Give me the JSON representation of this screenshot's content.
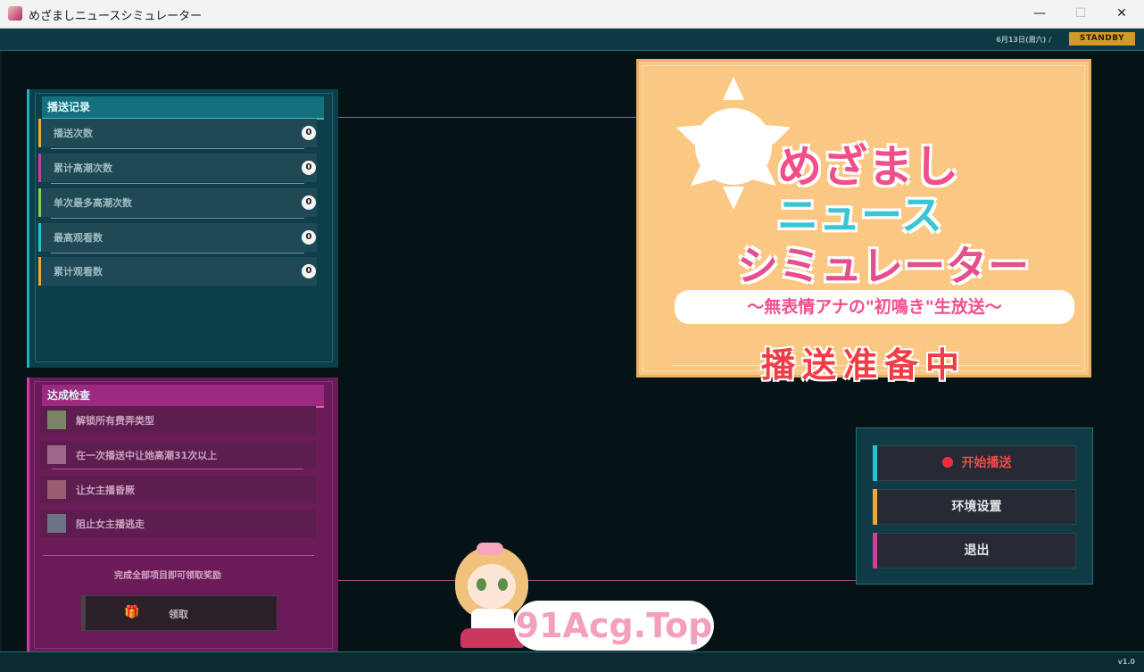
{
  "window": {
    "title": "めざましニュースシミュレーター",
    "minimize_symbol": "—",
    "maximize_symbol": "☐",
    "close_symbol": "✕"
  },
  "hud": {
    "date": "6月13日(周六) /",
    "status": "STANDBY"
  },
  "stats_panel": {
    "title": "播送记录",
    "rows": [
      {
        "label": "播送次数",
        "value": "0",
        "accent": "#f0a92c"
      },
      {
        "label": "累计高潮次数",
        "value": "0",
        "accent": "#d23a9c"
      },
      {
        "label": "单次最多高潮次数",
        "value": "0",
        "accent": "#8bd04b"
      },
      {
        "label": "最高观看数",
        "value": "0",
        "accent": "#21c4d7"
      },
      {
        "label": "累计观看数",
        "value": "0",
        "accent": "#f0a92c"
      }
    ]
  },
  "achievements_panel": {
    "title": "达成检查",
    "items": [
      {
        "label": "解锁所有费弄类型",
        "box_color": "#7a8466"
      },
      {
        "label": "在一次播送中让她高潮31次以上",
        "box_color": "#9c6788"
      },
      {
        "label": "让女主播昏厥",
        "box_color": "#9b5b70"
      },
      {
        "label": "阻止女主播逃走",
        "box_color": "#6b7384"
      }
    ],
    "note": "完成全部项目即可领取奖励",
    "claim_label": "领取",
    "claim_icon": "gift-icon"
  },
  "screen": {
    "logo_line1": "めざまし",
    "logo_line2": "ニュース",
    "logo_line3": "シミュレーター",
    "subtitle": "～無表情アナの\"初鳴き\"生放送～",
    "status": "播送准备中"
  },
  "menu": {
    "start_label": "开始播送",
    "start_icon": "record-icon",
    "settings_label": "环境设置",
    "exit_label": "退出",
    "start_accent": "#21c4d7",
    "settings_accent": "#f0a92c",
    "exit_accent": "#d23a9c"
  },
  "watermark": "91Acg.Top",
  "version": "v1.0",
  "colors": {
    "teal": "#0c3f49",
    "magenta": "#6a1b58",
    "gold": "#d39a2a",
    "record_red": "#ef2e3a"
  }
}
